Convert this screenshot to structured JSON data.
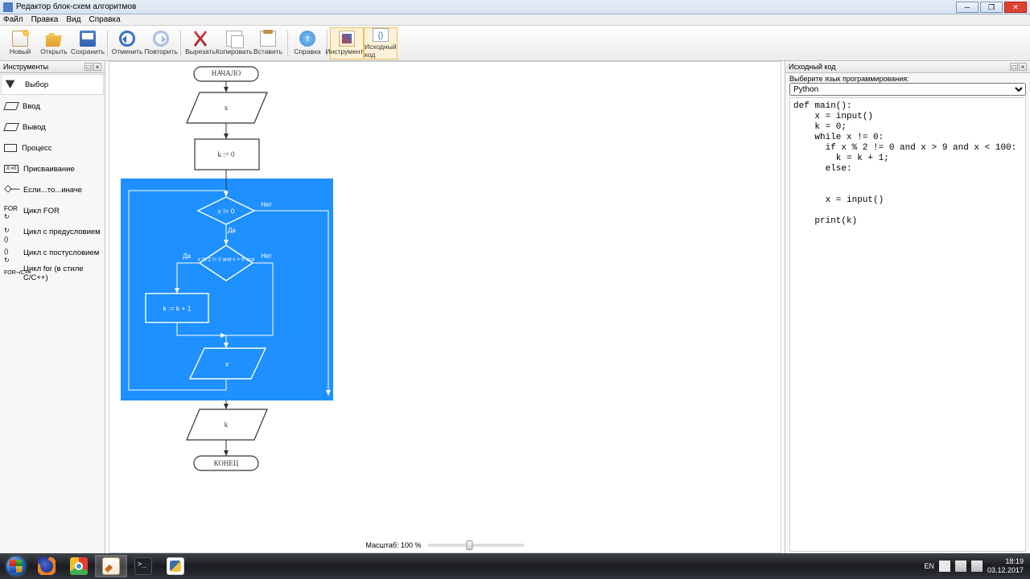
{
  "window": {
    "title": "Редактор блок-схем алгоритмов"
  },
  "menu": {
    "file": "Файл",
    "edit": "Правка",
    "view": "Вид",
    "help": "Справка"
  },
  "toolbar": {
    "new": "Новый",
    "open": "Открыть",
    "save": "Сохранить",
    "undo": "Отменить",
    "redo": "Повторить",
    "cut": "Вырезать",
    "copy": "Копировать",
    "paste": "Вставить",
    "helpBtn": "Справка",
    "tools": "Инструменты",
    "source": "Исходный код"
  },
  "leftPanel": {
    "title": "Инструменты",
    "items": {
      "select": "Выбор",
      "input": "Ввод",
      "output": "Вывод",
      "process": "Процесс",
      "assign": "Присваивание",
      "ifelse": "Если...то...иначе",
      "for": "Цикл FOR",
      "while": "Цикл с предусловием",
      "dowhile": "Цикл с постусловием",
      "cfor": "Цикл for (в стиле C/C++)"
    }
  },
  "flowchart": {
    "start": "НАЧАЛО",
    "end": "КОНЕЦ",
    "in1": "x",
    "proc1": "k := 0",
    "cond1": "x != 0",
    "cond1_no": "Нет",
    "cond1_yes": "Да",
    "cond2": "x % 2 != 0 and x > 9 and",
    "cond2_no": "Нет",
    "cond2_yes": "Да",
    "proc2": "k := k + 1",
    "in2": "x",
    "out1": "k"
  },
  "rightPanel": {
    "title": "Исходный код",
    "langLabel": "Выберите язык программирования:",
    "lang": "Python",
    "code": "def main():\n    x = input()\n    k = 0;\n    while x != 0:\n      if x % 2 != 0 and x > 9 and x < 100:\n        k = k + 1;\n      else:\n\n\n      x = input()\n\n    print(k)"
  },
  "zoom": {
    "label": "Масштаб: 100 %"
  },
  "tray": {
    "lang": "EN",
    "time": "18:19",
    "date": "03.12.2017"
  }
}
